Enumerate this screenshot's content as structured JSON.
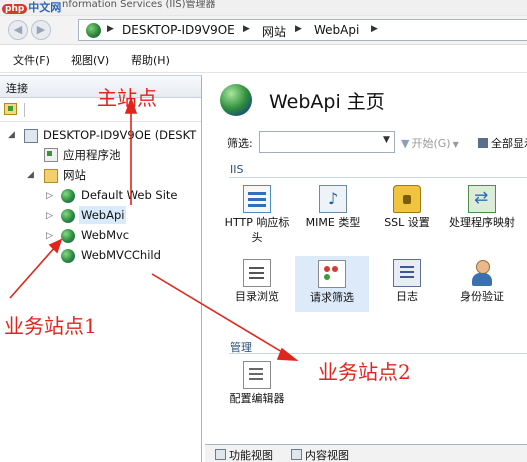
{
  "window": {
    "title": "nformation Services (IIS)管理器",
    "watermark_tag": "php",
    "watermark_text": "中文网"
  },
  "nav": {
    "back_icon": "back-arrow-icon",
    "forward_icon": "forward-arrow-icon",
    "breadcrumbs": [
      "DESKTOP-ID9V9OE",
      "网站",
      "WebApi"
    ]
  },
  "menu": {
    "items": [
      "文件(F)",
      "视图(V)",
      "帮助(H)"
    ]
  },
  "connections": {
    "title": "连接",
    "tree": {
      "server": "DESKTOP-ID9V9OE (DESKT",
      "app_pools": "应用程序池",
      "sites": "网站",
      "site_items": [
        "Default Web Site",
        "WebApi",
        "WebMvc",
        "WebMVCChild"
      ]
    }
  },
  "main": {
    "title": "WebApi 主页",
    "filter": {
      "label": "筛选:",
      "value": "",
      "go_label": "开始(G)",
      "show_all_label": "全部显示"
    },
    "sections": [
      {
        "label": "IIS",
        "features": [
          {
            "label": "HTTP 响应标头",
            "icon": "http-headers-icon"
          },
          {
            "label": "MIME 类型",
            "icon": "mime-types-icon"
          },
          {
            "label": "SSL 设置",
            "icon": "ssl-lock-icon"
          },
          {
            "label": "处理程序映射",
            "icon": "handler-mappings-icon"
          },
          {
            "label": "目录浏览",
            "icon": "directory-browsing-icon"
          },
          {
            "label": "请求筛选",
            "icon": "request-filtering-icon"
          },
          {
            "label": "日志",
            "icon": "logging-icon"
          },
          {
            "label": "身份验证",
            "icon": "authentication-icon"
          }
        ]
      },
      {
        "label": "管理",
        "features": [
          {
            "label": "配置编辑器",
            "icon": "configuration-editor-icon"
          }
        ]
      }
    ],
    "bottom_tabs": [
      "功能视图",
      "内容视图"
    ]
  },
  "annotations": {
    "main_site": "主站点",
    "business_site_1": "业务站点1",
    "business_site_2": "业务站点2",
    "color": "#e0251c"
  }
}
